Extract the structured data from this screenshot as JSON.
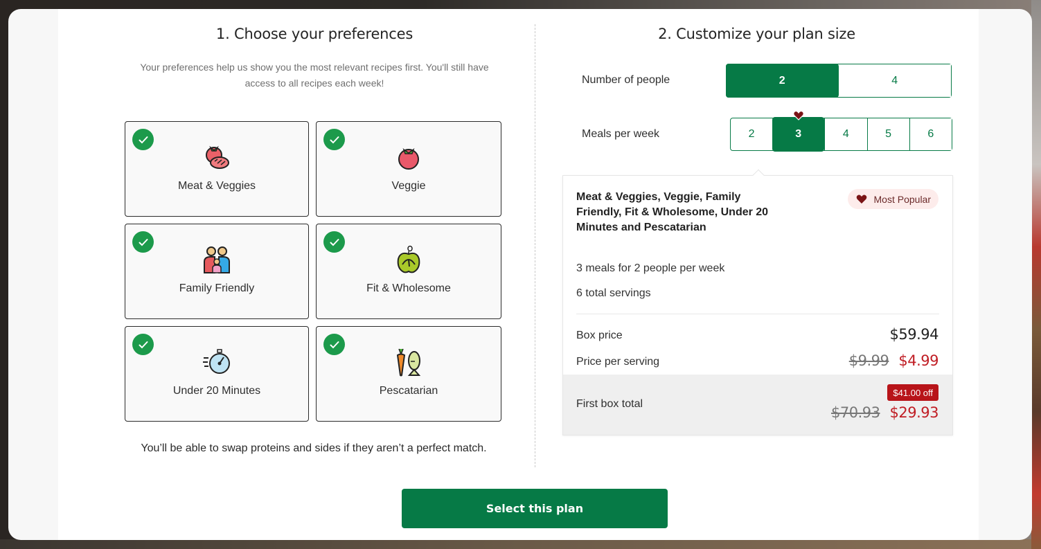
{
  "colors": {
    "brand_green": "#067a46",
    "check_green": "#1c9a4b",
    "discount_red": "#c01d24",
    "badge_red": "#b81419",
    "popular_bg": "#fdeceb"
  },
  "preferences": {
    "title": "1. Choose your preferences",
    "intro": "Your preferences help us show you the most relevant recipes first. You'll still have access to all recipes each week!",
    "items": [
      {
        "label": "Meat & Veggies",
        "icon": "steak-tomato-icon",
        "selected": true
      },
      {
        "label": "Veggie",
        "icon": "tomato-icon",
        "selected": true
      },
      {
        "label": "Family Friendly",
        "icon": "family-icon",
        "selected": true
      },
      {
        "label": "Fit & Wholesome",
        "icon": "apple-scale-icon",
        "selected": true
      },
      {
        "label": "Under 20 Minutes",
        "icon": "stopwatch-icon",
        "selected": true
      },
      {
        "label": "Pescatarian",
        "icon": "carrot-fish-icon",
        "selected": true
      }
    ],
    "swap_note": "You’ll be able to swap proteins and sides if they aren’t a perfect match."
  },
  "plan": {
    "title": "2. Customize your plan size",
    "people_label": "Number of people",
    "people_options": [
      "2",
      "4"
    ],
    "people_selected": "2",
    "meals_label": "Meals per week",
    "meals_options": [
      "2",
      "3",
      "4",
      "5",
      "6"
    ],
    "meals_selected": "3",
    "meals_popular": "3"
  },
  "summary": {
    "preferences_text": "Meat & Veggies, Veggie, Family Friendly, Fit & Wholesome, Under 20 Minutes and Pescatarian",
    "popular_badge": "Most Popular",
    "meals_line": "3 meals for 2 people per week",
    "servings_line": "6 total servings",
    "box_price_label": "Box price",
    "box_price": "$59.94",
    "per_serving_label": "Price per serving",
    "per_serving_original": "$9.99",
    "per_serving_discounted": "$4.99",
    "first_box_label": "First box total",
    "discount_badge": "$41.00 off",
    "first_box_original": "$70.93",
    "first_box_discounted": "$29.93"
  },
  "cta": {
    "label": "Select this plan"
  }
}
